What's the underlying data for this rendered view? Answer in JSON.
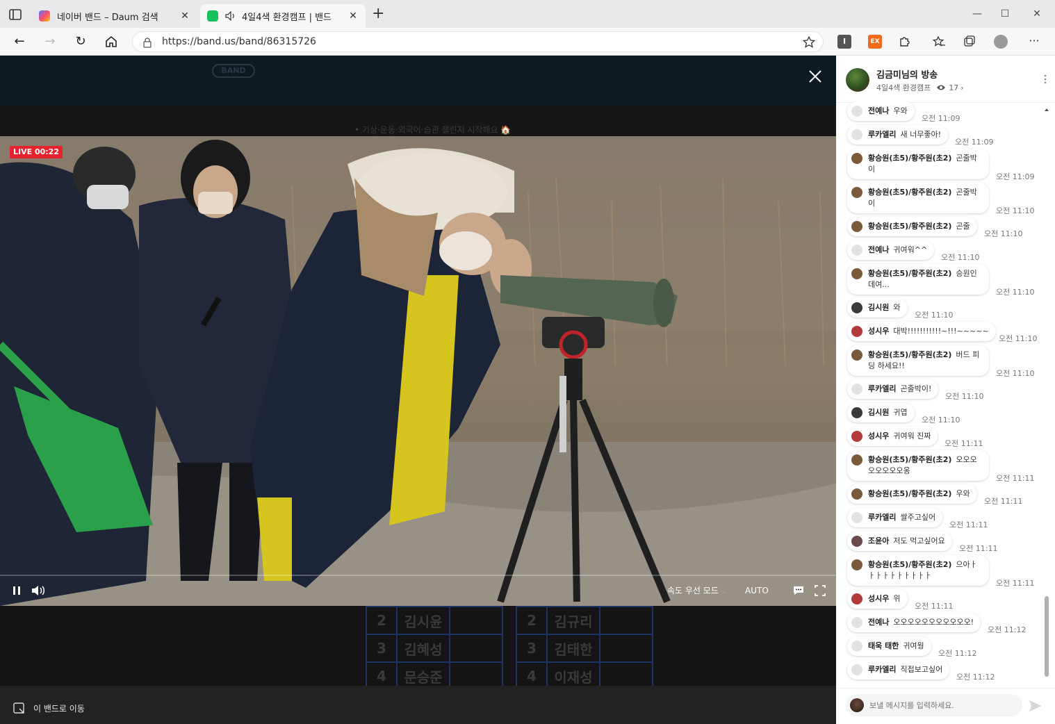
{
  "browser": {
    "tabs": [
      {
        "title": "네이버 밴드 – Daum 검색",
        "active": false
      },
      {
        "title": "4일4색 환경캠프 | 밴드",
        "active": true
      }
    ],
    "url": "https://band.us/band/86315726"
  },
  "viewer": {
    "live_label": "LIVE 00:22",
    "speed_mode": "속도 우선 모드",
    "quality": "AUTO",
    "goto_band": "이 밴드로 이동",
    "bg_notice": "• 기상·운동·외국어·습관 챌린지 시작해요 🏠",
    "groups_left": [
      {
        "num": "2",
        "name": "김시윤"
      },
      {
        "num": "3",
        "name": "김혜성"
      },
      {
        "num": "4",
        "name": "문승준"
      }
    ],
    "groups_right": [
      {
        "num": "2",
        "name": "김규리"
      },
      {
        "num": "3",
        "name": "김태한"
      },
      {
        "num": "4",
        "name": "이재성"
      }
    ]
  },
  "chat": {
    "title": "김금미님의 방송",
    "band_name": "4일4색 환경캠프",
    "viewers": "17",
    "input_placeholder": "보낼 메시지를 입력하세요.",
    "messages": [
      {
        "name": "전예나",
        "text": "우와",
        "time": "오전 11:09"
      },
      {
        "name": "루카엘리",
        "text": "새 너무좋아!",
        "time": "오전 11:09"
      },
      {
        "name": "황승원(초5)/황주원(초2)",
        "text": "곤줄박",
        "text2": "이",
        "time": "오전 11:09"
      },
      {
        "name": "황승원(초5)/황주원(초2)",
        "text": "곤줄박",
        "text2": "이",
        "time": "오전 11:10"
      },
      {
        "name": "황승원(초5)/황주원(초2)",
        "text": "곤줄",
        "time": "오전 11:10"
      },
      {
        "name": "전예나",
        "text": "귀여워^^",
        "time": "오전 11:10"
      },
      {
        "name": "황승원(초5)/황주원(초2)",
        "text": "승원인",
        "text2": "데여...",
        "time": "오전 11:10"
      },
      {
        "name": "김시원",
        "text": "와",
        "time": "오전 11:10"
      },
      {
        "name": "성시우",
        "text": "대박!!!!!!!!!!!~!!!~~~~~",
        "time": "오전 11:10"
      },
      {
        "name": "황승원(초5)/황주원(초2)",
        "text": "버드 피",
        "text2": "딩 하세요!!",
        "time": "오전 11:10"
      },
      {
        "name": "루카엘리",
        "text": "곤줄박이!",
        "time": "오전 11:10"
      },
      {
        "name": "김시원",
        "text": "귀엽",
        "time": "오전 11:10"
      },
      {
        "name": "성시우",
        "text": "귀여워 진짜",
        "time": "오전 11:11"
      },
      {
        "name": "황승원(초5)/황주원(초2)",
        "text": "오오오",
        "text2": "오오오오오옹",
        "time": "오전 11:11"
      },
      {
        "name": "황승원(초5)/황주원(초2)",
        "text": "우와",
        "time": "오전 11:11"
      },
      {
        "name": "루카엘리",
        "text": "쌀주고싶어",
        "time": "오전 11:11"
      },
      {
        "name": "조윤아",
        "text": "저도 먹고싶어요",
        "time": "오전 11:11"
      },
      {
        "name": "황승원(초5)/황주원(초2)",
        "text": "으아ㅏ",
        "text2": "ㅏㅏㅏㅏㅏㅏㅏㅏㅏ",
        "time": "오전 11:11"
      },
      {
        "name": "성시우",
        "text": "위",
        "time": "오전 11:11"
      },
      {
        "name": "전예나",
        "text": "오오오오오오오오오오오!",
        "time": "오전 11:12"
      },
      {
        "name": "태욱 태한",
        "text": "귀여웡",
        "time": "오전 11:12"
      },
      {
        "name": "루카엘리",
        "text": "직접보고싶어",
        "time": "오전 11:12"
      }
    ]
  }
}
